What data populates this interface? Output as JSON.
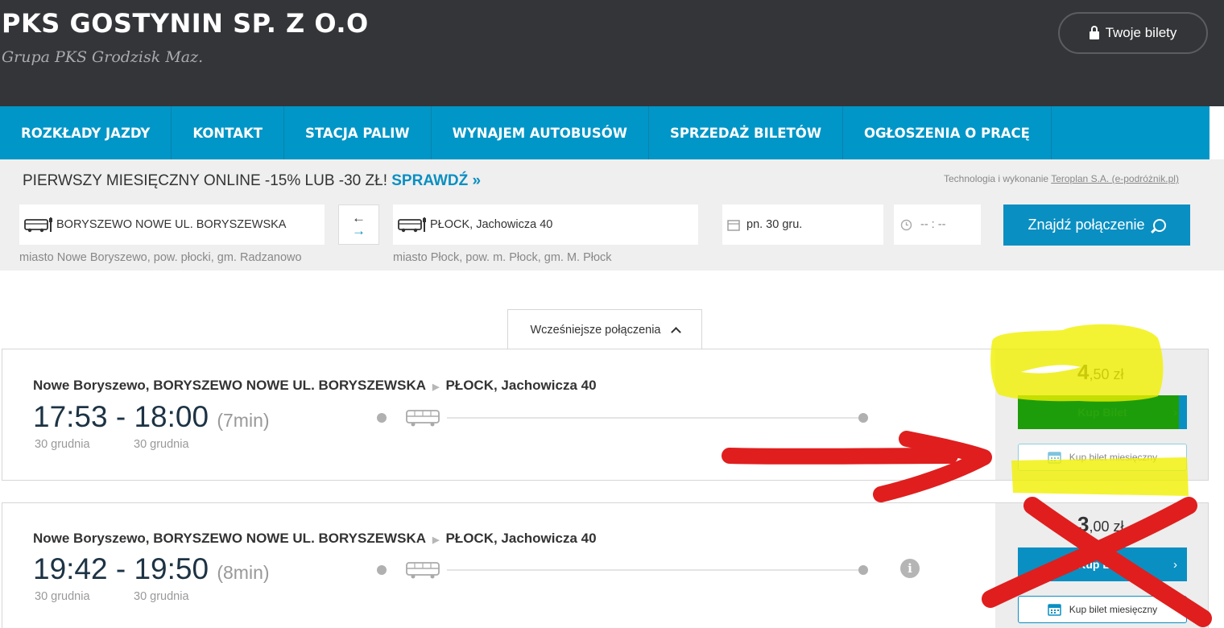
{
  "header": {
    "title": "PKS GOSTYNIN SP. Z O.O",
    "subtitle": "Grupa PKS Grodzisk Maz.",
    "tickets_label": "Twoje bilety"
  },
  "nav": {
    "items": [
      "ROZKŁADY JAZDY",
      "KONTAKT",
      "STACJA PALIW",
      "WYNAJEM AUTOBUSÓW",
      "SPRZEDAŻ BILETÓW",
      "OGŁOSZENIA O PRACĘ"
    ]
  },
  "promo": {
    "text": "PIERWSZY MIESIĘCZNY ONLINE -15% LUB -30 ZŁ! ",
    "link": "SPRAWDŹ »"
  },
  "tech": {
    "prefix": "Technologia i wykonanie ",
    "link": "Teroplan S.A. (e-podróżnik.pl)"
  },
  "search": {
    "from": "BORYSZEWO NOWE UL. BORYSZEWSKA",
    "from_hint": "miasto Nowe Boryszewo, pow. płocki, gm. Radzanowo",
    "to": "PŁOCK, Jachowicza 40",
    "to_hint": "miasto Płock, pow. m. Płock, gm. M. Płock",
    "date": "pn. 30 gru.",
    "time": "-- : --",
    "find_label": "Znajdź połączenie"
  },
  "earlier_label": "Wcześniejsze połączenia",
  "connections": [
    {
      "origin": "Nowe Boryszewo, BORYSZEWO NOWE UL. BORYSZEWSKA",
      "destination": "PŁOCK, Jachowicza 40",
      "departure": "17:53",
      "arrival": "18:00",
      "duration": "(7min)",
      "departure_date": "30 grudnia",
      "arrival_date": "30 grudnia",
      "price_whole": "4",
      "price_rest": ",50 zł",
      "buy_label": "Kup Bilet",
      "monthly_label": "Kup bilet miesięczny"
    },
    {
      "origin": "Nowe Boryszewo, BORYSZEWO NOWE UL. BORYSZEWSKA",
      "destination": "PŁOCK, Jachowicza 40",
      "departure": "19:42",
      "arrival": "19:50",
      "duration": "(8min)",
      "departure_date": "30 grudnia",
      "arrival_date": "30 grudnia",
      "price_whole": "3",
      "price_rest": ",00 zł",
      "buy_label": "Kup Bilet",
      "monthly_label": "Kup bilet miesięczny",
      "info_icon": "i"
    }
  ],
  "colors": {
    "header_bg": "#333538",
    "nav_bg": "#0096c7",
    "accent": "#0a8fc2",
    "highlight_yellow": "#f0f000",
    "annotation_red": "#e01e1e",
    "annotation_green": "#1f9e00"
  }
}
